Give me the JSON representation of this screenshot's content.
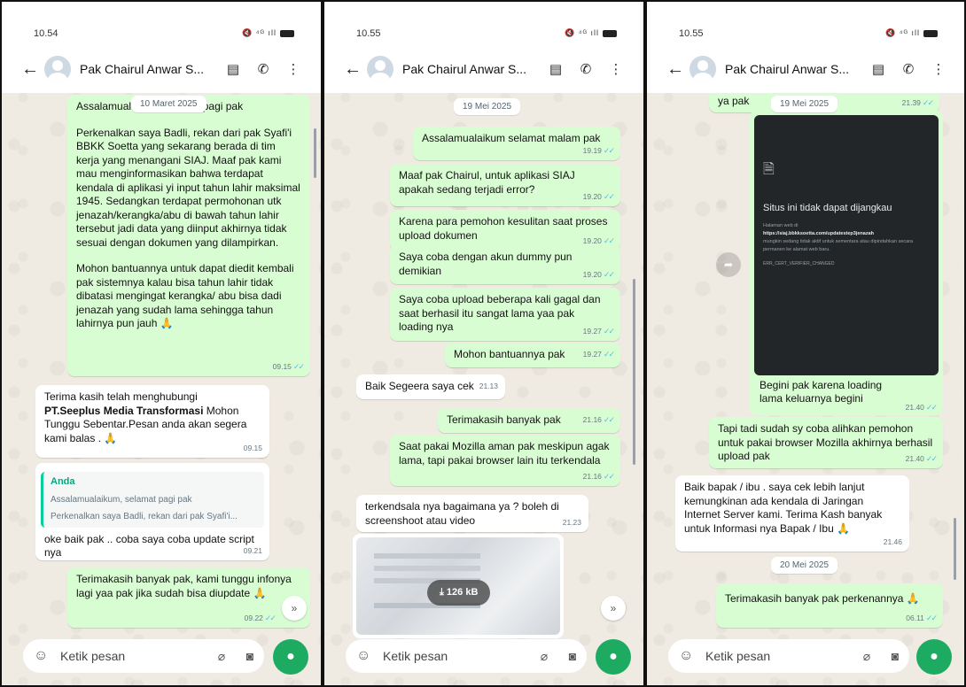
{
  "panels": [
    {
      "status_time": "10.54",
      "status_icons": "🔇 ⁴ᴳ ıll",
      "contact_name": "Pak Chairul Anwar S...",
      "date_label": "10 Maret 2025",
      "messages": [
        {
          "paragraphs": [
            "Assalamualaikum selamat pagi pak",
            "Perkenalkan saya Badli, rekan dari pak Syafi'i BBKK Soetta yang sekarang berada di tim kerja yang menangani SIAJ. Maaf pak kami mau menginformasikan bahwa terdapat kendala di aplikasi yi input tahun lahir maksimal 1945. Sedangkan terdapat permohonan utk jenazah/kerangka/abu di bawah tahun lahir tersebut jadi data yang diinput akhirnya tidak sesuai dengan dokumen yang dilampirkan.",
            "Mohon bantuannya untuk dapat diedit kembali pak sistemnya kalau bisa tahun lahir tidak dibatasi mengingat kerangka/ abu bisa dadi jenazah yang sudah lama sehingga tahun lahirnya pun jauh 🙏"
          ],
          "time": "09.15",
          "ticks": "✓✓"
        },
        {
          "line1": "Terima kasih telah menghubungi",
          "bold": "PT.Seeplus Media Transformasi",
          "rest": " Mohon Tunggu Sebentar.Pesan anda akan segera kami balas . 🙏",
          "time": "09.15"
        },
        {
          "quote_name": "Anda",
          "quote_line1": "Assalamualaikum, selamat pagi pak",
          "quote_line2": "Perkenalkan saya Badli, rekan dari pak Syafi'i...",
          "text": "oke baik pak .. coba saya coba update script nya",
          "time": "09.21"
        },
        {
          "text": "Terimakasih banyak pak, kami tunggu infonya lagi yaa pak jika sudah bisa diupdate 🙏",
          "time": "09.22",
          "ticks": "✓✓"
        }
      ],
      "fab": "»"
    },
    {
      "status_time": "10.55",
      "status_icons": "🔇 ⁴ᴳ ıll",
      "contact_name": "Pak Chairul Anwar S...",
      "date_label": "19 Mei 2025",
      "messages": [
        {
          "text": "Assalamualaikum selamat malam pak",
          "time": "19.19",
          "ticks": "✓✓"
        },
        {
          "text": "Maaf pak Chairul, untuk aplikasi SIAJ apakah sedang terjadi error?",
          "time": "19.20",
          "ticks": "✓✓"
        },
        {
          "text": "Karena para pemohon kesulitan saat proses upload dokumen",
          "time": "19.20",
          "ticks": "✓✓"
        },
        {
          "text": "Saya coba dengan akun dummy pun demikian",
          "time": "19.20",
          "ticks": "✓✓"
        },
        {
          "text": "Saya coba upload beberapa kali gagal dan saat berhasil itu sangat lama yaa pak loading nya",
          "time": "19.27",
          "ticks": "✓✓"
        },
        {
          "text": "Mohon bantuannya pak",
          "time": "19.27",
          "ticks": "✓✓"
        },
        {
          "text": "Baik Segeera saya cek",
          "time": "21.13"
        },
        {
          "text": "Terimakasih banyak pak",
          "time": "21.16",
          "ticks": "✓✓"
        },
        {
          "text": "Saat pakai Mozilla aman pak meskipun agak lama, tapi pakai browser lain itu terkendala",
          "time": "21.16",
          "ticks": "✓✓"
        },
        {
          "text": "terkendsala nya bagaimana ya ? boleh di screenshoot atau video",
          "time": "21.23"
        }
      ],
      "download_size": "126 kB",
      "fab": "»"
    },
    {
      "status_time": "10.55",
      "status_icons": "🔇 ⁴ᴳ ıll",
      "contact_name": "Pak Chairul Anwar S...",
      "date_label": "19 Mei 2025",
      "date_label2": "20 Mei 2025",
      "messages": [
        {
          "text": "ya pak",
          "time": "21.39",
          "ticks": "✓✓"
        },
        {
          "caption": "Begini pak karena loading lama keluarnya begini",
          "time": "21.40",
          "ticks": "✓✓"
        },
        {
          "text": "Tapi tadi sudah sy coba alihkan pemohon untuk pakai browser Mozilla akhirnya berhasil upload pak",
          "time": "21.40",
          "ticks": "✓✓"
        },
        {
          "text": "Baik bapak / ibu . saya cek lebih lanjut kemungkinan ada kendala di Jaringan Internet Server kami. Terima Kash banyak untuk Informasi nya Bapak / Ibu 🙏",
          "time": "21.46"
        },
        {
          "text": "Terimakasih banyak pak perkenannya 🙏",
          "time": "06.11",
          "ticks": "✓✓"
        }
      ],
      "error_page": {
        "title": "Situs ini tidak dapat dijangkau",
        "line1": "Halaman web di",
        "url": "https://siaj.bbkksoetta.com/updatestep3jenazah",
        "line2": "mungkin sedang tidak aktif untuk sementara atau dipindahkan secara permanen ke alamat web baru.",
        "code": "ERR_CERT_VERIFIER_CHANGED"
      }
    }
  ],
  "input": {
    "placeholder": "Ketik pesan"
  }
}
